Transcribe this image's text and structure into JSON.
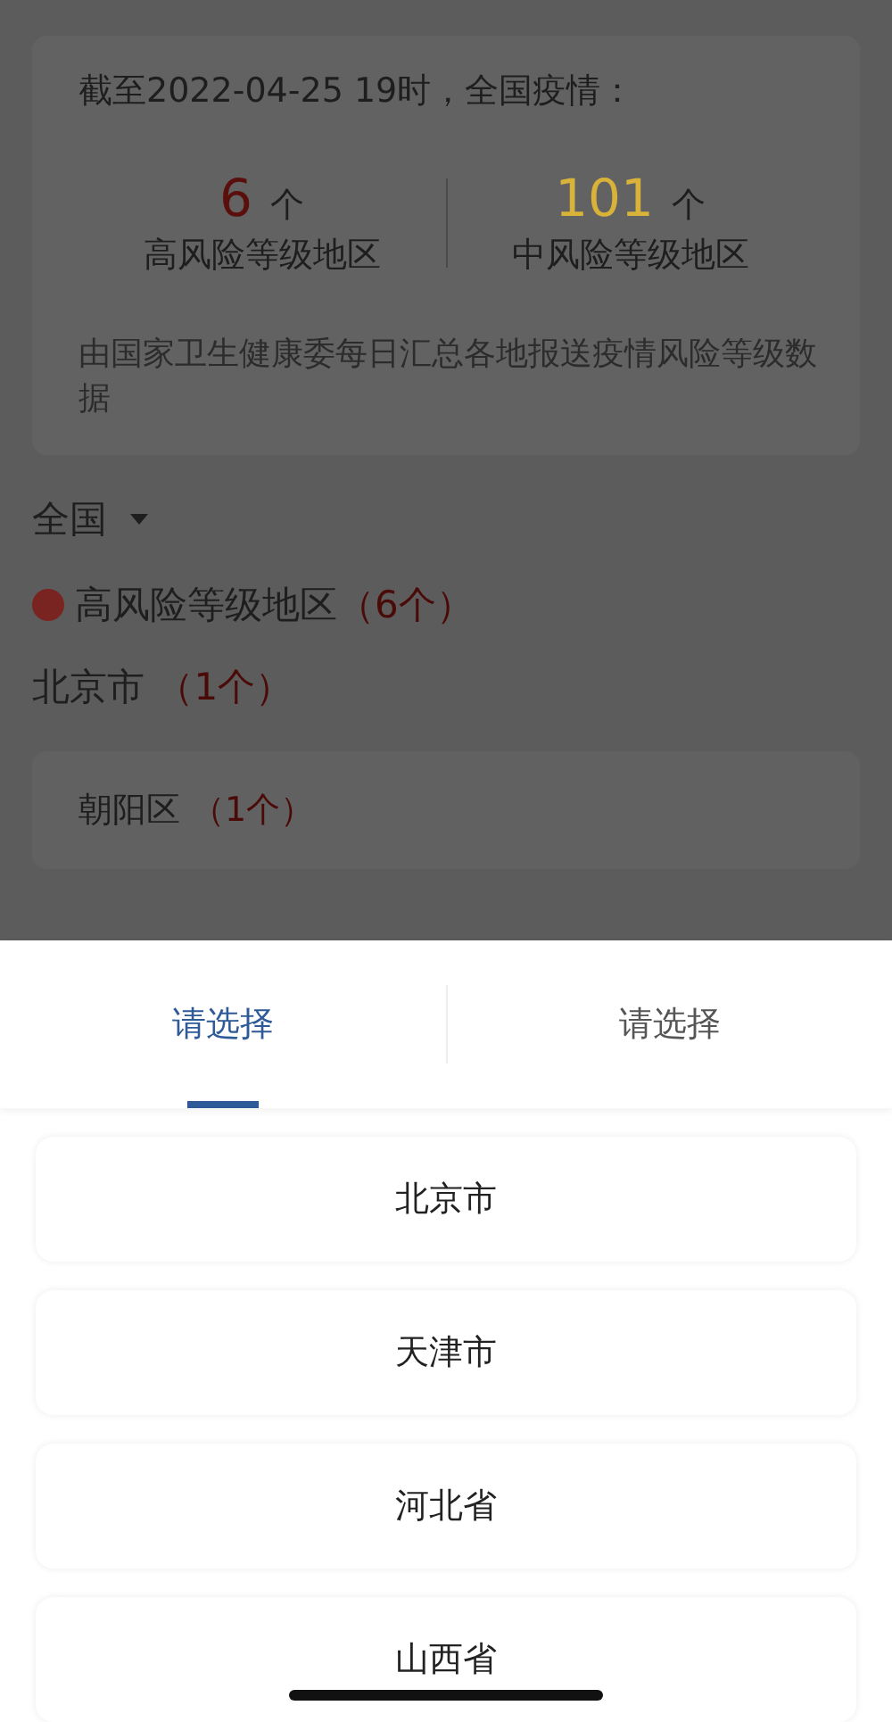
{
  "summary": {
    "title": "截至2022-04-25 19时，全国疫情：",
    "stats": [
      {
        "count": "6",
        "unit": "个",
        "label": "高风险等级地区",
        "color": "#5a0f0d"
      },
      {
        "count": "101",
        "unit": "个",
        "label": "中风险等级地区",
        "color": "#d9b23a"
      }
    ],
    "note": "由国家卫生健康委每日汇总各地报送疫情风险等级数据"
  },
  "region_filter": {
    "label": "全国"
  },
  "high_risk": {
    "title": "高风险等级地区",
    "count": "（6个）",
    "color": "#7a2422"
  },
  "provinces": [
    {
      "name": "北京市",
      "count": "（1个）",
      "districts": [
        {
          "name": "朝阳区",
          "count": "（1个）"
        }
      ]
    }
  ],
  "picker": {
    "tabs": [
      {
        "label": "请选择",
        "selected": true
      },
      {
        "label": "请选择",
        "selected": false
      }
    ],
    "options": [
      "北京市",
      "天津市",
      "河北省",
      "山西省"
    ]
  }
}
